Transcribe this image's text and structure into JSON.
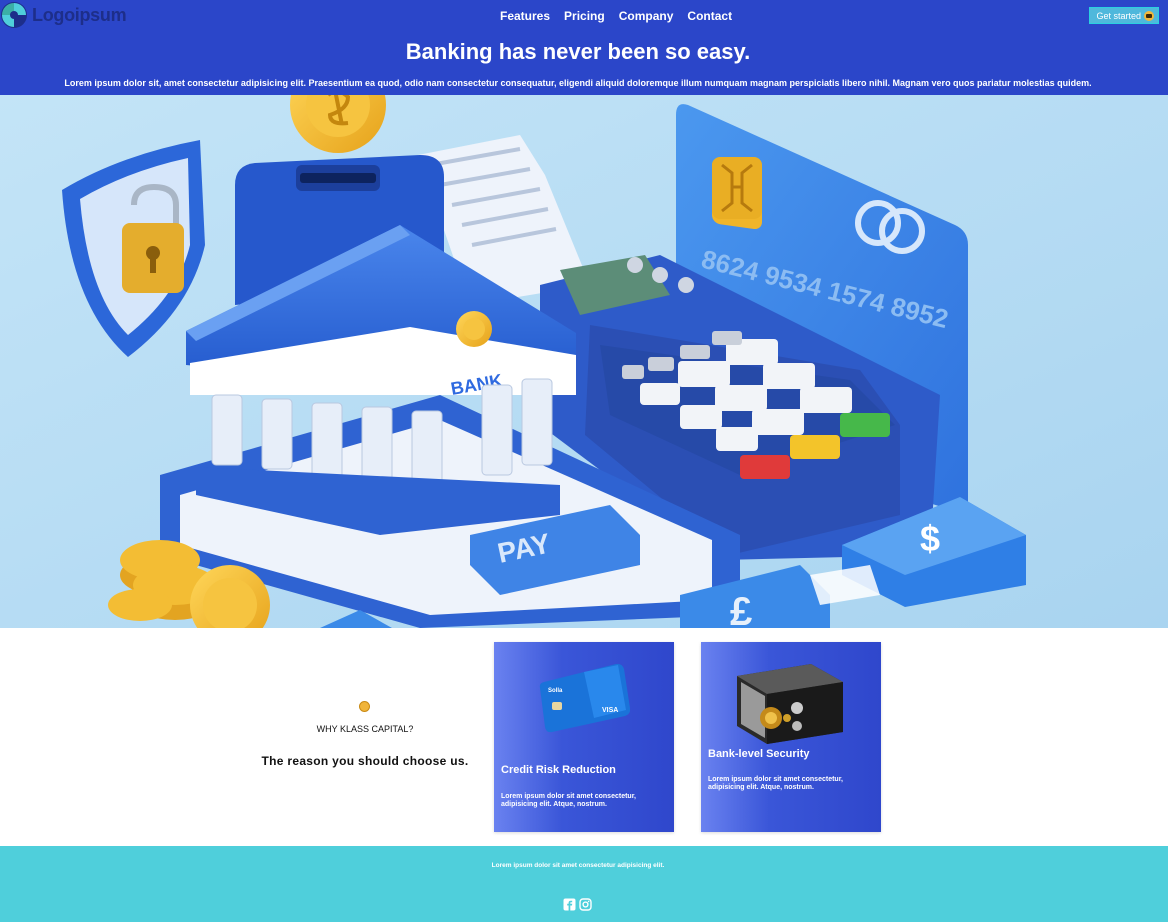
{
  "brand": {
    "name": "Logoipsum"
  },
  "nav": {
    "items": [
      {
        "label": "Features"
      },
      {
        "label": "Pricing"
      },
      {
        "label": "Company"
      },
      {
        "label": "Contact"
      }
    ],
    "cta_label": "Get started"
  },
  "hero": {
    "title": "Banking has never been so easy.",
    "subtitle": "Lorem ipsum dolor sit, amet consectetur adipisicing elit. Praesentium ea quod, odio nam consectetur consequatur, eligendi aliquid doloremque illum numquam magnam perspiciatis libero nihil. Magnam vero quos pariatur molestias quidem.",
    "card_number": "8624 9534 1574 8952",
    "bank_sign": "BANK",
    "pay_label": "PAY",
    "card_brand": "VISA",
    "card_logo": "Solla"
  },
  "why": {
    "kicker": "WHY KLASS CAPITAL?",
    "title": "The reason you should choose us."
  },
  "features": [
    {
      "title": "Credit Risk Reduction",
      "text": "Lorem ipsum dolor sit amet consectetur, adipisicing elit. Atque, nostrum."
    },
    {
      "title": "Bank-level Security",
      "text": "Lorem ipsum dolor sit amet consectetur, adipisicing elit. Atque, nostrum."
    }
  ],
  "footer": {
    "text": "Lorem ipsum dolor sit amet consectetur adipisicing elit."
  },
  "social": [
    {
      "icon": "facebook-icon"
    },
    {
      "icon": "instagram-icon"
    }
  ],
  "colors": {
    "header_bg": "#2b46c9",
    "cta_bg": "#4fb8dc",
    "hero_bg": "#b3dcf3",
    "footer_bg": "#4fcfdb",
    "card_bg": "#2f47cc"
  }
}
